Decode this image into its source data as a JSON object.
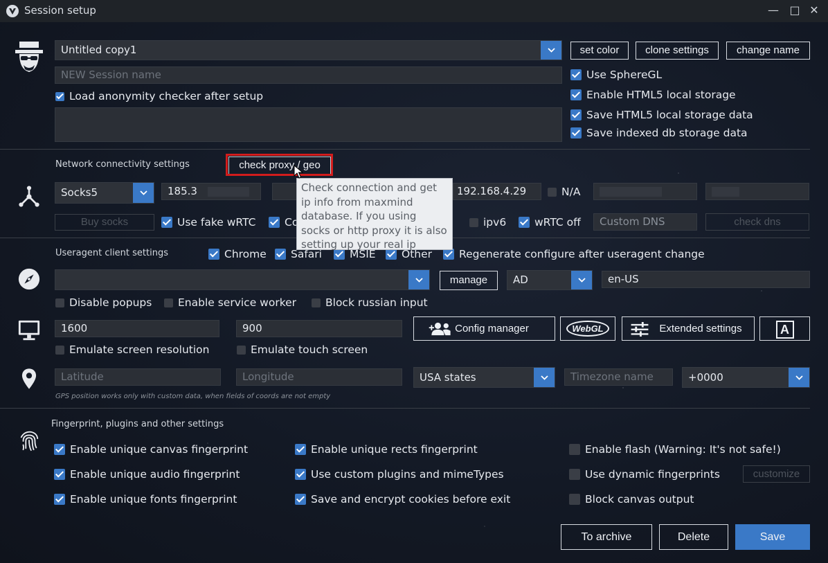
{
  "window": {
    "title": "Session setup",
    "minimize": "—",
    "maximize": "□",
    "close": "✕"
  },
  "session": {
    "selected": "Untitled copy1",
    "name_placeholder": "NEW Session name",
    "set_color": "set color",
    "clone_settings": "clone settings",
    "change_name": "change name",
    "load_anon_checker": "Load anonymity checker after setup",
    "use_spheregl": "Use SphereGL",
    "enable_html5": "Enable HTML5 local storage",
    "save_html5": "Save HTML5 local storage data",
    "save_indexed": "Save indexed db storage data"
  },
  "network": {
    "section": "Network connectivity settings",
    "check_proxy": "check proxy / geo",
    "proxy_type": "Socks5",
    "proxy_host": "185.3",
    "local_ip": "192.168.4.29",
    "na_label": "N/A",
    "buy_socks": "Buy socks",
    "fake_webrtc": "Use fake wRTC",
    "co_label": "Co",
    "ipv6": "ipv6",
    "webrtc_off": "wRTC off",
    "custom_dns_placeholder": "Custom DNS",
    "check_dns": "check dns",
    "tooltip": "Check connection and get ip info from maxmind database. If you using socks or http proxy it is also setting up your real ip"
  },
  "useragent": {
    "section": "Useragent client settings",
    "chrome": "Chrome",
    "safari": "Safari",
    "msie": "MSIE",
    "other": "Other",
    "regenerate": "Regenerate configure after useragent change",
    "manage": "manage",
    "country": "AD",
    "lang": "en-US",
    "disable_popups": "Disable popups",
    "service_worker": "Enable service worker",
    "block_russian": "Block russian input"
  },
  "screen": {
    "width": "1600",
    "height": "900",
    "config_manager": "Config manager",
    "webgl": "WebGL",
    "extended": "Extended settings",
    "font_btn": "A",
    "emulate_res": "Emulate screen resolution",
    "emulate_touch": "Emulate touch screen"
  },
  "geo": {
    "lat_placeholder": "Latitude",
    "lon_placeholder": "Longitude",
    "states": "USA states",
    "tz_placeholder": "Timezone name",
    "tz_offset": "+0000",
    "note": "GPS position works only with custom data, when fields of coords are not empty"
  },
  "fingerprint": {
    "section": "Fingerprint, plugins and other settings",
    "canvas": "Enable unique canvas fingerprint",
    "audio": "Enable unique audio fingerprint",
    "fonts": "Enable unique fonts fingerprint",
    "rects": "Enable unique rects fingerprint",
    "plugins": "Use custom plugins and mimeTypes",
    "cookies": "Save and encrypt cookies before exit",
    "flash": "Enable flash (Warning: It's not safe!)",
    "dynamic": "Use dynamic fingerprints",
    "customize": "customize",
    "block_canvas": "Block canvas output"
  },
  "actions": {
    "archive": "To archive",
    "delete": "Delete",
    "save": "Save"
  },
  "colors": {
    "accent": "#3a79c7",
    "highlight": "#d21c1c",
    "bg": "#131925"
  }
}
